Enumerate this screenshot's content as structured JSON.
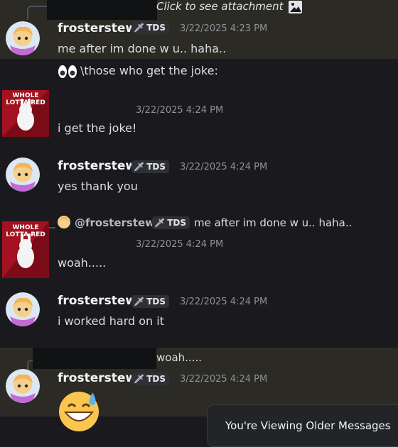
{
  "colors": {
    "background": "#1a1a1e",
    "highlight_band": "#2b2a24",
    "username": "#f2f3f5",
    "text": "#dbdee1",
    "timestamp": "#8e9297",
    "tag_bg": "#2e3035",
    "reply_username": "#b5bac1"
  },
  "top_reply": {
    "text": "Click to see attachment"
  },
  "messages": [
    {
      "username": "frosterstew",
      "tag": "TDS",
      "timestamp": "3/22/2025 4:23 PM",
      "lines": [
        "me after im done w u.. haha..",
        "\\those who get the joke:"
      ],
      "icons": [
        "eyes-emoji"
      ]
    },
    {
      "timestamp": "3/22/2025 4:24 PM",
      "text": "i get the joke!",
      "avatar_text": "WHOLE LOTTA RED"
    },
    {
      "username": "frosterstew",
      "tag": "TDS",
      "timestamp": "3/22/2025 4:24 PM",
      "text": "yes thank you"
    },
    {
      "reply": {
        "username": "@frosterstew",
        "tag": "TDS",
        "text": "me after im done w u.. haha.."
      },
      "timestamp": "3/22/2025 4:24 PM",
      "text": "woah.....",
      "avatar_text": "WHOLE LOTTA RED"
    },
    {
      "username": "frosterstew",
      "tag": "TDS",
      "timestamp": "3/22/2025 4:24 PM",
      "text": "i worked hard on it"
    },
    {
      "reply": {
        "text": "woah....."
      },
      "username": "frosterstew",
      "tag": "TDS",
      "timestamp": "3/22/2025 4:24 PM",
      "icons": [
        "grinning-sweat-emoji"
      ]
    }
  ],
  "toast": {
    "text": "You're Viewing Older Messages"
  }
}
